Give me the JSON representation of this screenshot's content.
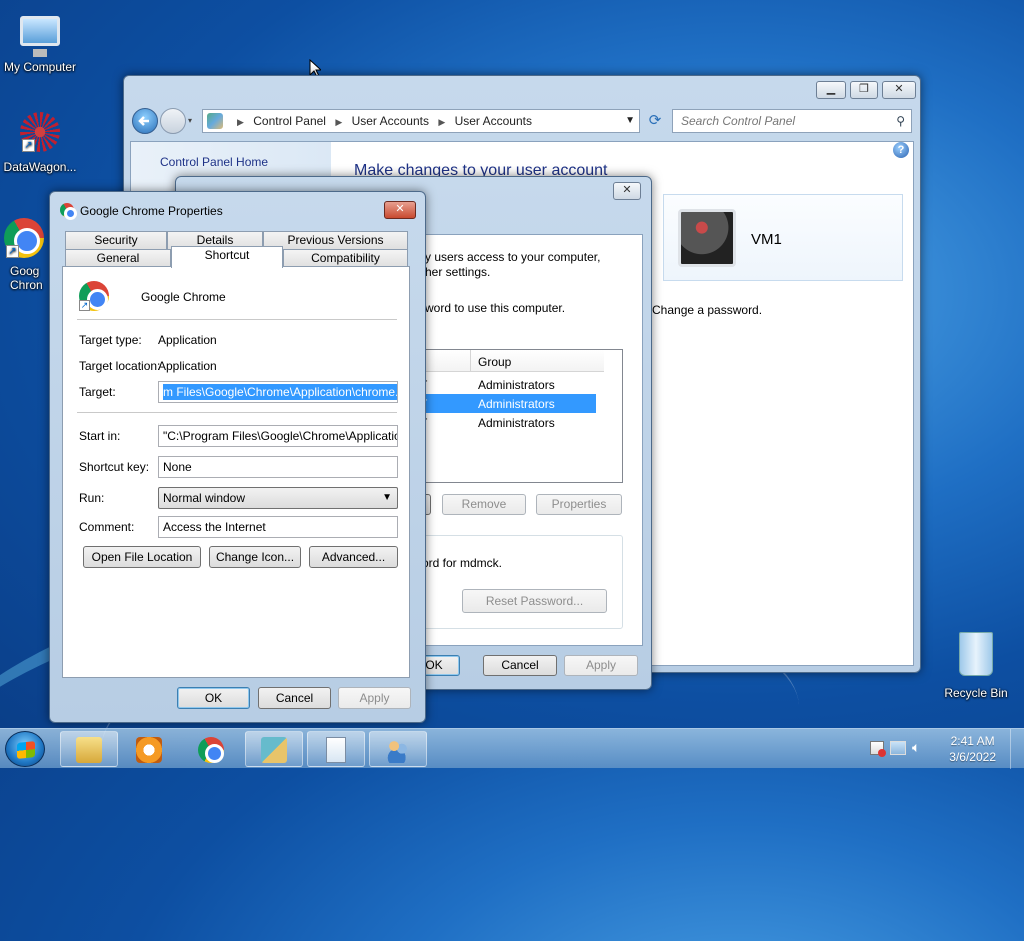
{
  "desktop": {
    "icons": [
      {
        "label": "My Computer"
      },
      {
        "label": "DataWagon..."
      },
      {
        "label": "Goog\nChron"
      },
      {
        "label": "Recycle Bin"
      }
    ]
  },
  "control_panel": {
    "breadcrumb": [
      "Control Panel",
      "User Accounts",
      "User Accounts"
    ],
    "search_placeholder": "Search Control Panel",
    "left_link": "Control Panel Home",
    "heading": "Make changes to your user account",
    "user_name": "VM1",
    "change_password": "Change a password."
  },
  "user_accounts_dialog": {
    "text_line1": "y users access to your computer,",
    "text_line2": "her settings.",
    "text_line3": "word to use this computer.",
    "group_header": "Group",
    "rows": [
      {
        "left": "ET",
        "group": "Administrators"
      },
      {
        "left": "ET",
        "group": "Administrators"
      },
      {
        "left": "ET",
        "group": "Administrators"
      }
    ],
    "remove_label": "Remove",
    "properties_label": "Properties",
    "password_text": "ord for mdmck.",
    "reset_label": "Reset Password...",
    "ok_label": "OK",
    "cancel_label": "Cancel",
    "apply_label": "Apply"
  },
  "chrome_props": {
    "title": "Google Chrome Properties",
    "tabs_row1": [
      "Security",
      "Details",
      "Previous Versions"
    ],
    "tabs_row2": [
      "General",
      "Shortcut",
      "Compatibility"
    ],
    "app_name": "Google Chrome",
    "target_type_label": "Target type:",
    "target_type_value": "Application",
    "target_location_label": "Target location:",
    "target_location_value": "Application",
    "target_label": "Target:",
    "target_value": "m Files\\Google\\Chrome\\Application\\chrome.exe\"",
    "start_in_label": "Start in:",
    "start_in_value": "\"C:\\Program Files\\Google\\Chrome\\Application\"",
    "shortcut_key_label": "Shortcut key:",
    "shortcut_key_value": "None",
    "run_label": "Run:",
    "run_value": "Normal window",
    "comment_label": "Comment:",
    "comment_value": "Access the Internet",
    "open_file_location": "Open File Location",
    "change_icon": "Change Icon...",
    "advanced": "Advanced...",
    "ok_label": "OK",
    "cancel_label": "Cancel",
    "apply_label": "Apply"
  },
  "taskbar": {
    "time": "2:41 AM",
    "date": "3/6/2022"
  },
  "colors": {
    "selection": "#3399ff",
    "link": "#1e3287",
    "heading": "#1e3287"
  }
}
